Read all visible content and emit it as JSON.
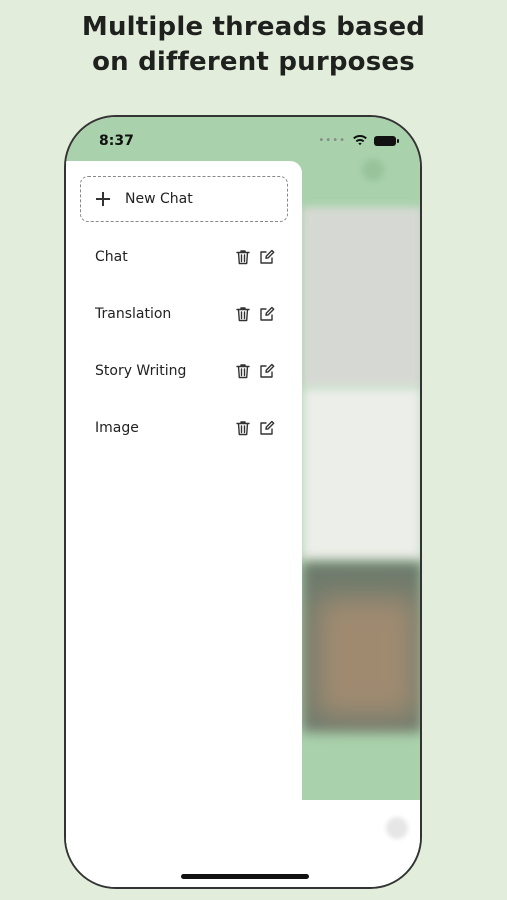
{
  "headline": {
    "line1": "Multiple threads based",
    "line2": "on different purposes"
  },
  "status_bar": {
    "time": "8:37",
    "icons": [
      "signal-icon",
      "wifi-icon",
      "battery-icon"
    ]
  },
  "drawer": {
    "new_chat_label": "New Chat",
    "threads": [
      {
        "label": "Chat"
      },
      {
        "label": "Translation"
      },
      {
        "label": "Story Writing"
      },
      {
        "label": "Image"
      }
    ]
  },
  "colors": {
    "page_background": "#e3eddb",
    "app_accent": "#a9d2ac"
  }
}
